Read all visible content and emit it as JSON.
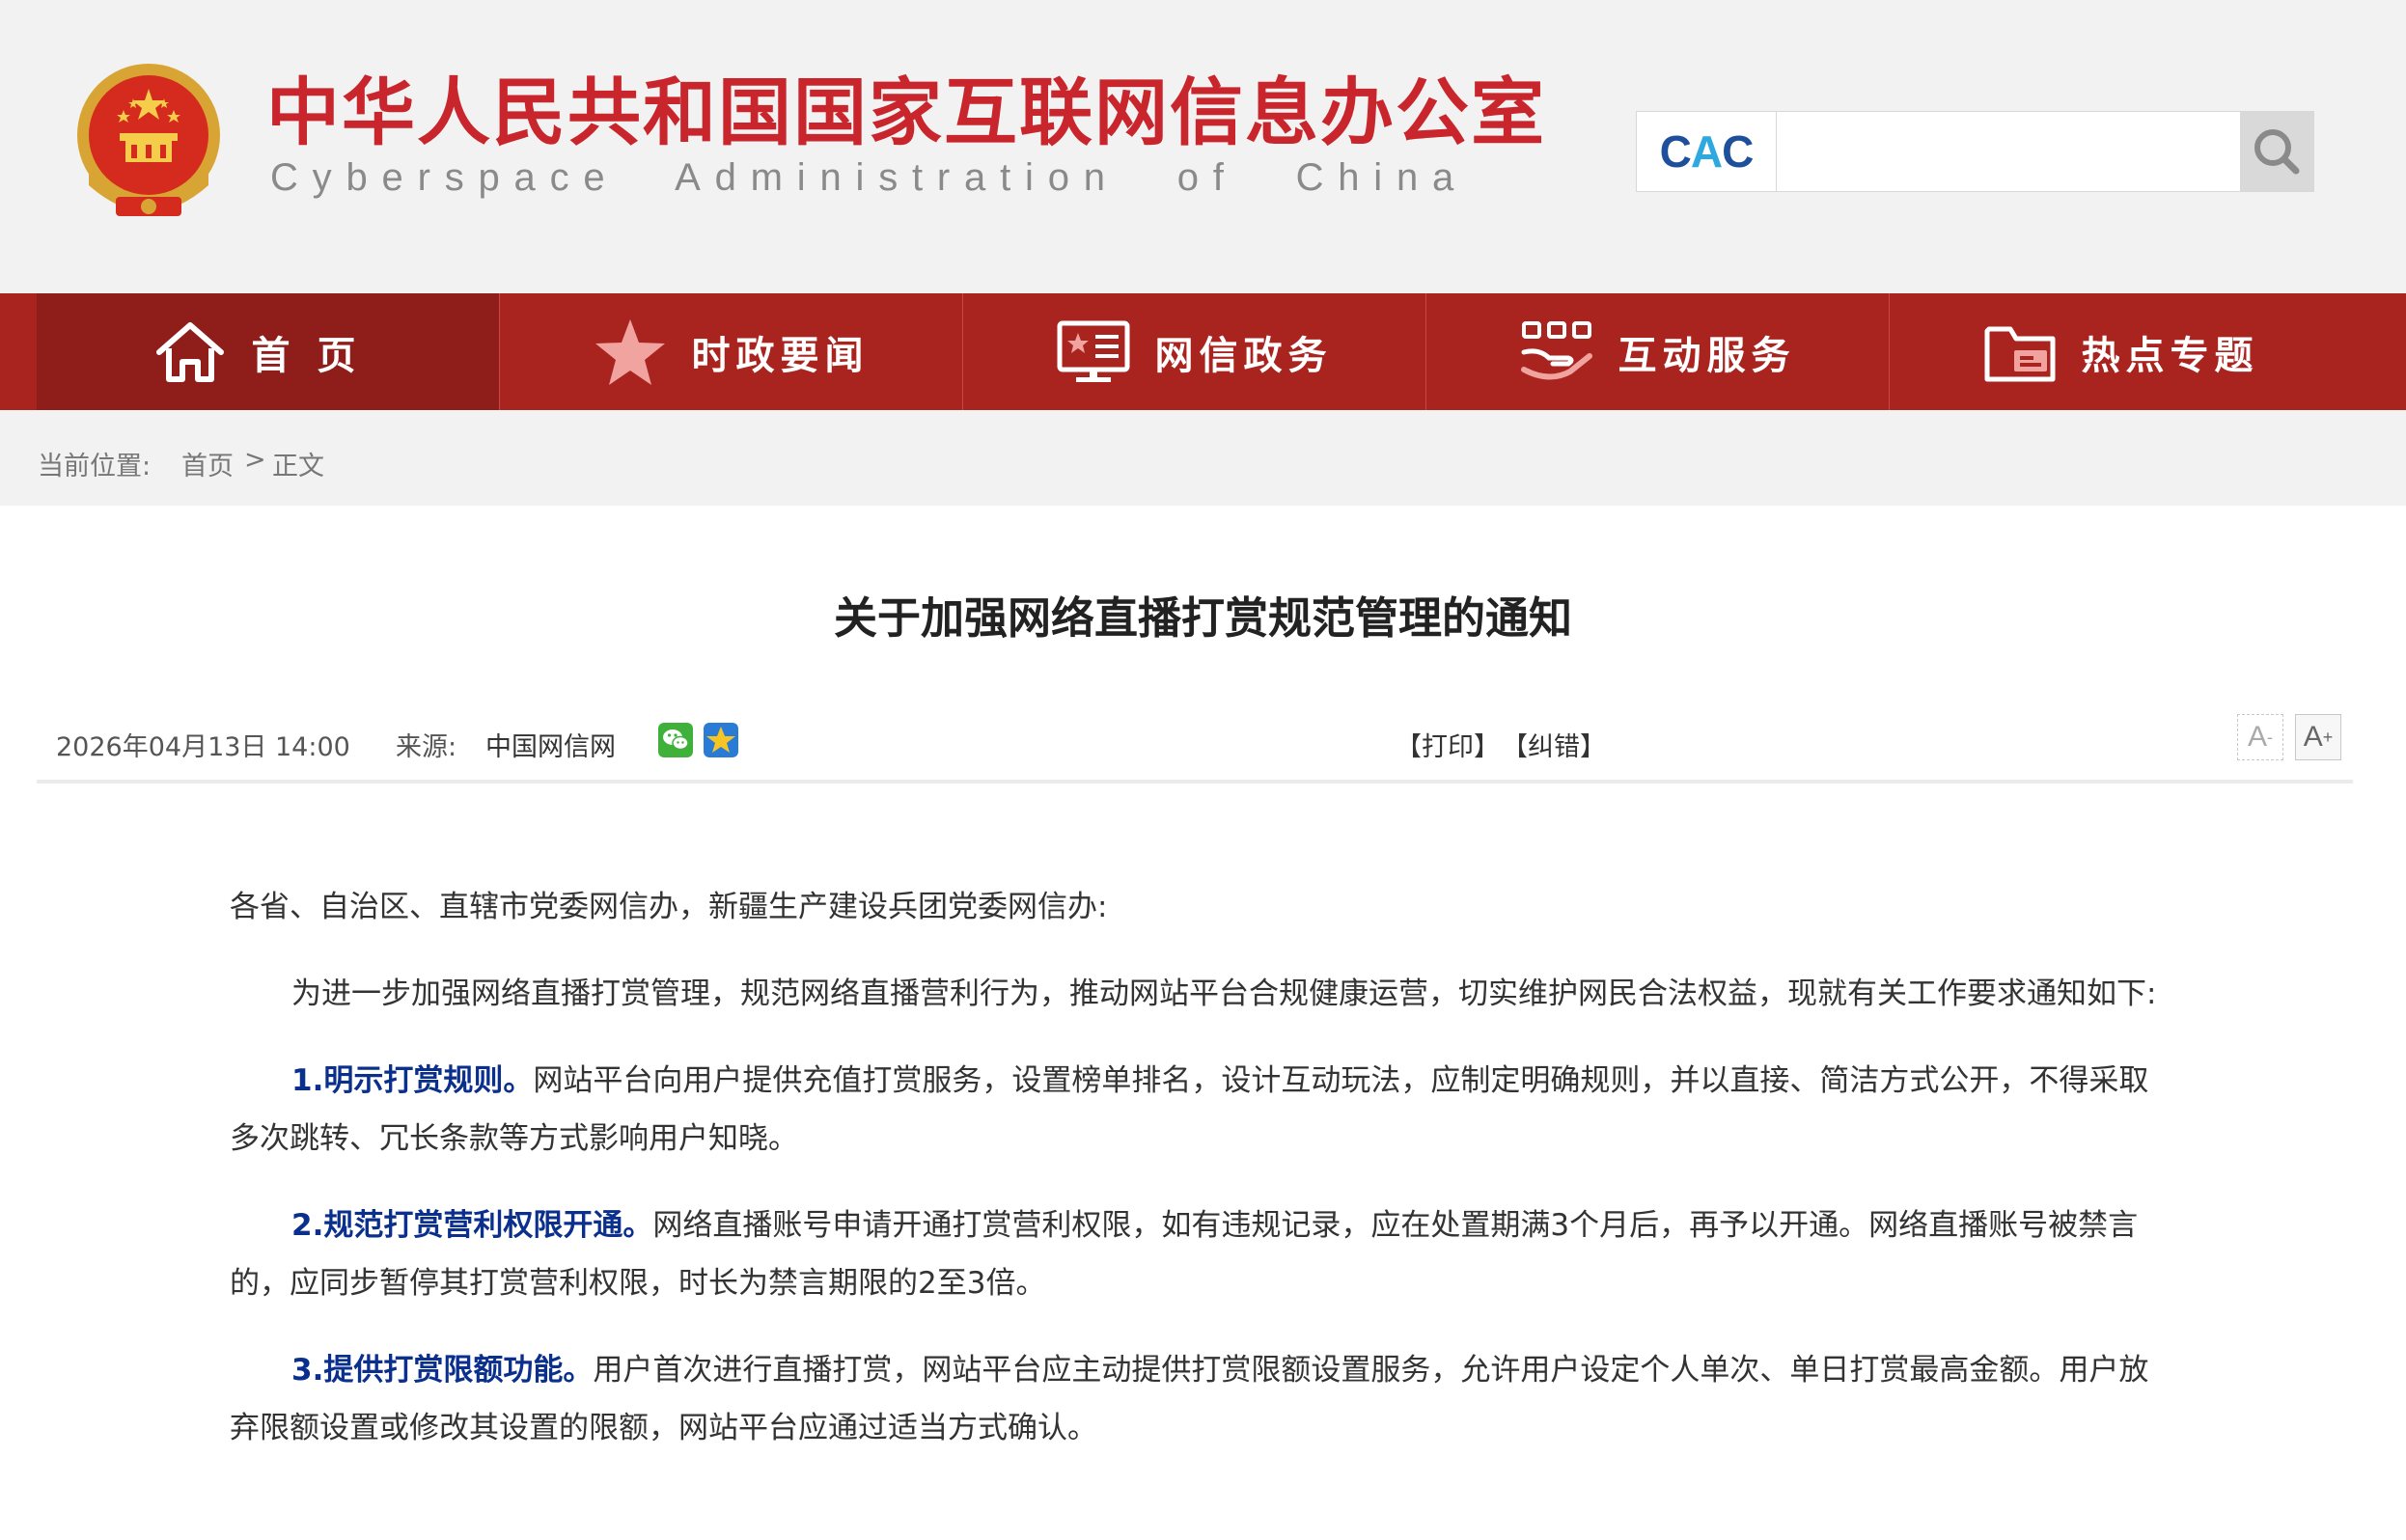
{
  "header": {
    "title_cn": "中华人民共和国国家互联网信息办公室",
    "title_en": "Cyberspace Administration of China",
    "search": {
      "logo_text_a": "C",
      "logo_text_b": "A",
      "logo_text_c": "C",
      "placeholder": ""
    }
  },
  "nav": {
    "items": [
      {
        "label": "首页",
        "icon": "home-icon",
        "active": true
      },
      {
        "label": "时政要闻",
        "icon": "star-icon",
        "active": false
      },
      {
        "label": "网信政务",
        "icon": "board-icon",
        "active": false
      },
      {
        "label": "互动服务",
        "icon": "interaction-icon",
        "active": false
      },
      {
        "label": "热点专题",
        "icon": "folder-icon",
        "active": false
      }
    ]
  },
  "breadcrumb": {
    "prefix": "当前位置:",
    "home": "首页",
    "sep": ">",
    "current": "正文"
  },
  "article": {
    "title": "关于加强网络直播打赏规范管理的通知",
    "datetime": "2026年04月13日 14:00",
    "source_label": "来源:",
    "source": "中国网信网",
    "print": "【打印】",
    "correction": "【纠错】",
    "font_small": "A",
    "font_large": "A",
    "font_small_mark": "-",
    "font_large_mark": "+",
    "paragraphs": [
      {
        "lead": "",
        "text": "各省、自治区、直辖市党委网信办，新疆生产建设兵团党委网信办:"
      },
      {
        "lead": "",
        "text": "为进一步加强网络直播打赏管理，规范网络直播营利行为，推动网站平台合规健康运营，切实维护网民合法权益，现就有关工作要求通知如下:"
      },
      {
        "lead": "1.明示打赏规则。",
        "text": "网站平台向用户提供充值打赏服务，设置榜单排名，设计互动玩法，应制定明确规则，并以直接、简洁方式公开，不得采取多次跳转、冗长条款等方式影响用户知晓。"
      },
      {
        "lead": "2.规范打赏营利权限开通。",
        "text": "网络直播账号申请开通打赏营利权限，如有违规记录，应在处置期满3个月后，再予以开通。网络直播账号被禁言的，应同步暂停其打赏营利权限，时长为禁言期限的2至3倍。"
      },
      {
        "lead": "3.提供打赏限额功能。",
        "text": "用户首次进行直播打赏，网站平台应主动提供打赏限额设置服务，允许用户设定个人单次、单日打赏最高金额。用户放弃限额设置或修改其设置的限额，网站平台应通过适当方式确认。"
      }
    ]
  },
  "colors": {
    "brand_red": "#c8262c",
    "nav_red": "#a9231f",
    "nav_active": "#8f1d1a",
    "highlight_blue": "#0a2f8c"
  }
}
